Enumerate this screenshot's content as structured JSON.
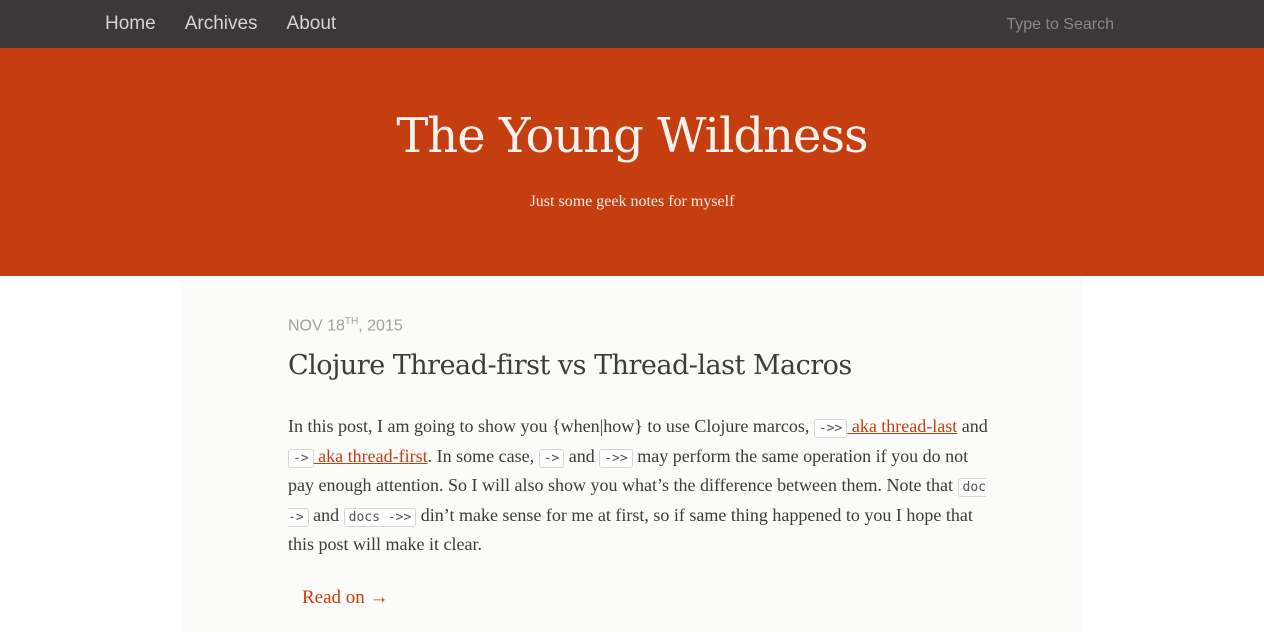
{
  "nav": {
    "items": [
      {
        "label": "Home"
      },
      {
        "label": "Archives"
      },
      {
        "label": "About"
      }
    ],
    "search_placeholder": "Type to Search"
  },
  "header": {
    "title": "The Young Wildness",
    "subtitle": "Just some geek notes for myself"
  },
  "post": {
    "date": {
      "month_day": "Nov 18",
      "ordinal": "th",
      "year": ", 2015"
    },
    "title": "Clojure Thread-first vs Thread-last Macros",
    "body": {
      "t1": "In this post, I am going to show you {when|how} to use Clojure marcos, ",
      "code1": "->>",
      "link1": " aka thread-last",
      "t2": " and ",
      "code2": "->",
      "link2": " aka thread-first",
      "t3": ". In some case, ",
      "code3": "->",
      "t4": " and ",
      "code4": "->>",
      "t5": " may perform the same operation if you do not pay enough attention. So I will also show you what’s the difference between them. Note that ",
      "code5": "doc ->",
      "t6": " and ",
      "code6": "docs ->>",
      "t7": " din’t make sense for me at first, so if same thing happened to you I hope that this post will make it clear."
    },
    "read_on": "Read on →"
  },
  "colors": {
    "nav_bg": "#3a3838",
    "accent": "#c53e0f",
    "text": "#3e3c3a"
  }
}
